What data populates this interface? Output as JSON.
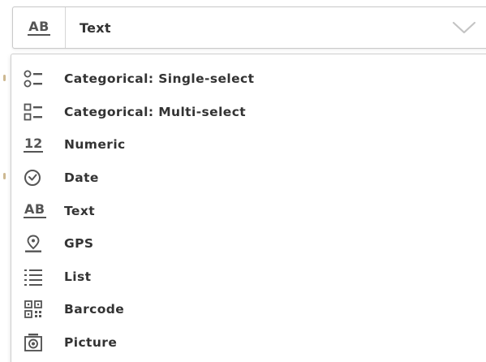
{
  "select": {
    "selected_label": "Text",
    "selected_icon": "text-ab-icon",
    "chevron_icon": "chevron-down-icon"
  },
  "menu": {
    "items": [
      {
        "label": "Categorical: Single-select",
        "icon": "single-select-icon"
      },
      {
        "label": "Categorical: Multi-select",
        "icon": "multi-select-icon"
      },
      {
        "label": "Numeric",
        "icon": "numeric-icon",
        "icon_text": "12"
      },
      {
        "label": "Date",
        "icon": "clock-icon"
      },
      {
        "label": "Text",
        "icon": "text-ab-icon",
        "icon_text": "AB"
      },
      {
        "label": "GPS",
        "icon": "location-pin-icon"
      },
      {
        "label": "List",
        "icon": "list-icon"
      },
      {
        "label": "Barcode",
        "icon": "barcode-icon"
      },
      {
        "label": "Picture",
        "icon": "camera-icon"
      }
    ]
  },
  "select_icon_text": "AB",
  "colors": {
    "icon": "#555555",
    "text": "#333333",
    "border": "#c9c9c9",
    "chevron": "#c4c4c4"
  }
}
